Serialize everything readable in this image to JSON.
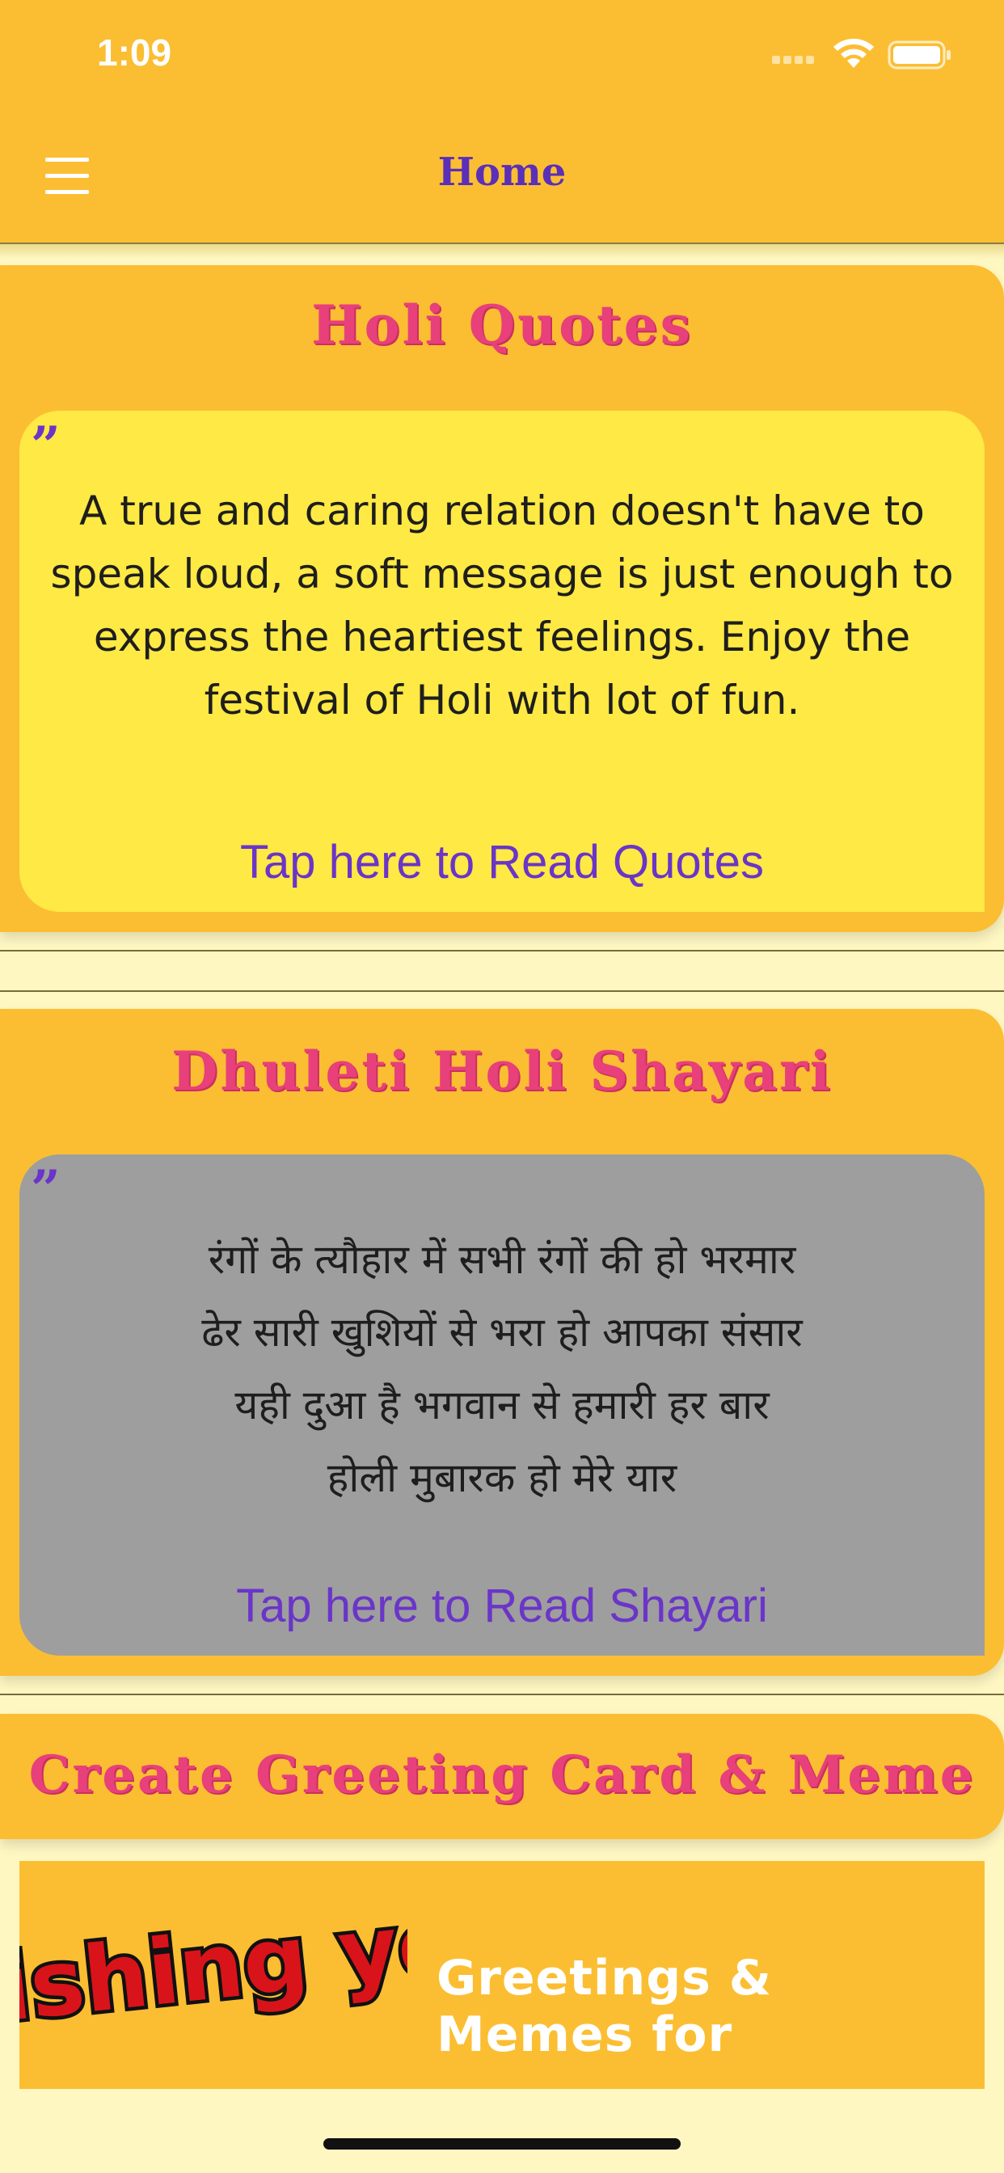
{
  "status_bar": {
    "time": "1:09"
  },
  "nav": {
    "title": "Home"
  },
  "quotes_section": {
    "title": "Holi Quotes",
    "quote": "A true and caring relation doesn't have to speak loud, a soft message is just enough to express the heartiest feelings. Enjoy the festival of Holi with lot of fun.",
    "link": "Tap here to Read Quotes"
  },
  "shayari_section": {
    "title": "Dhuleti Holi Shayari",
    "lines": [
      "रंगों के त्यौहार में सभी रंगों की हो भरमार",
      "ढेर सारी खुशियों से भरा हो आपका संसार",
      "यही दुआ है भगवान से हमारी हर बार",
      "होली मुबारक हो मेरे यार"
    ],
    "link": "Tap here to Read Shayari"
  },
  "greeting_section": {
    "title": "Create Greeting Card & Meme",
    "banner_art_text": "Wishing you",
    "banner_text": "Greetings & Memes for"
  },
  "colors": {
    "primary": "#fbbe32",
    "accent_purple": "#6a35c8",
    "title_pink": "#e8407a",
    "quote_card": "#ffe944",
    "shayari_card": "#9e9e9e",
    "background": "#fff7c2"
  },
  "icons": [
    "menu-icon",
    "wifi-icon",
    "battery-icon",
    "signal-icon",
    "quote-mark-icon"
  ]
}
